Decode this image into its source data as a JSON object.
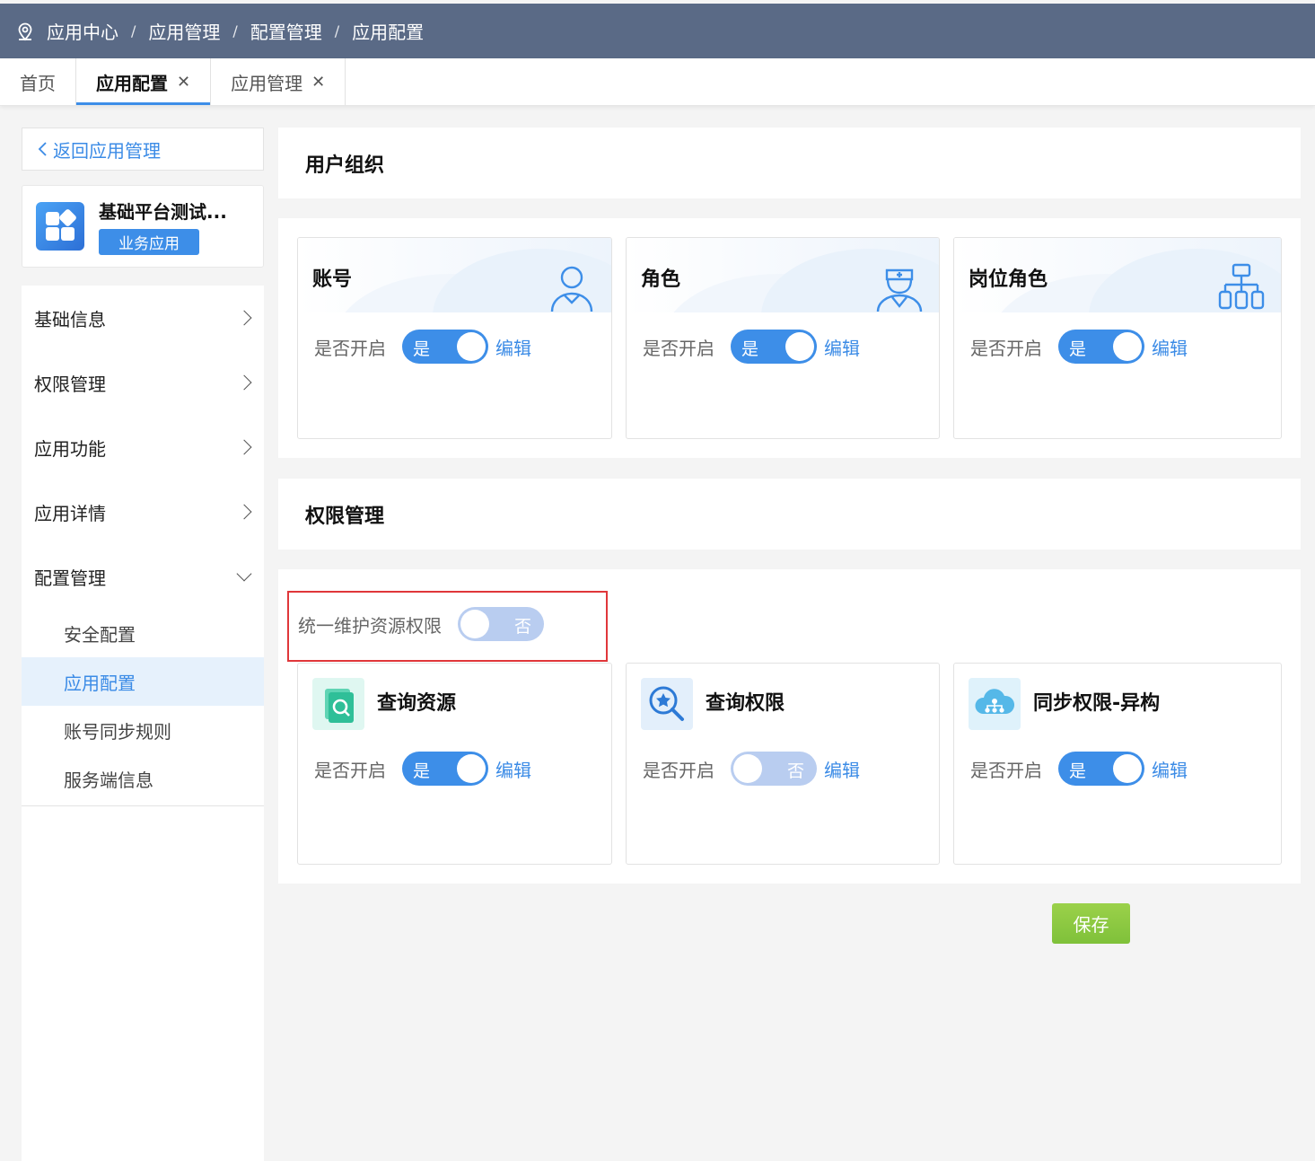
{
  "breadcrumb": [
    "应用中心",
    "应用管理",
    "配置管理",
    "应用配置"
  ],
  "breadcrumb_sep": "/",
  "tabs": [
    {
      "label": "首页",
      "closable": false,
      "active": false
    },
    {
      "label": "应用配置",
      "closable": true,
      "active": true
    },
    {
      "label": "应用管理",
      "closable": true,
      "active": false
    }
  ],
  "close_glyph": "✕",
  "sidebar": {
    "back_label": "返回应用管理",
    "app_name": "基础平台测试...",
    "app_tag": "业务应用",
    "menu": [
      {
        "label": "基础信息",
        "expanded": false
      },
      {
        "label": "权限管理",
        "expanded": false
      },
      {
        "label": "应用功能",
        "expanded": false
      },
      {
        "label": "应用详情",
        "expanded": false
      },
      {
        "label": "配置管理",
        "expanded": true
      }
    ],
    "submenu": [
      {
        "label": "安全配置",
        "active": false
      },
      {
        "label": "应用配置",
        "active": true
      },
      {
        "label": "账号同步规则",
        "active": false
      },
      {
        "label": "服务端信息",
        "active": false
      }
    ]
  },
  "sections": {
    "user_org": {
      "title": "用户组织",
      "cards": [
        {
          "title": "账号",
          "icon": "user-icon",
          "row_label": "是否开启",
          "enabled": true,
          "switch_label": "是",
          "edit_label": "编辑"
        },
        {
          "title": "角色",
          "icon": "doctor-icon",
          "row_label": "是否开启",
          "enabled": true,
          "switch_label": "是",
          "edit_label": "编辑"
        },
        {
          "title": "岗位角色",
          "icon": "org-chart-icon",
          "row_label": "是否开启",
          "enabled": true,
          "switch_label": "是",
          "edit_label": "编辑"
        }
      ]
    },
    "permission": {
      "title": "权限管理",
      "unified_label": "统一维护资源权限",
      "unified_enabled": false,
      "unified_switch_label": "否",
      "cards": [
        {
          "title": "查询资源",
          "icon": "search-resource-icon",
          "row_label": "是否开启",
          "enabled": true,
          "switch_label": "是",
          "edit_label": "编辑"
        },
        {
          "title": "查询权限",
          "icon": "search-permission-icon",
          "row_label": "是否开启",
          "enabled": false,
          "switch_label": "否",
          "edit_label": "编辑"
        },
        {
          "title": "同步权限-异构",
          "icon": "cloud-sync-icon",
          "row_label": "是否开启",
          "enabled": true,
          "switch_label": "是",
          "edit_label": "编辑"
        }
      ]
    }
  },
  "save_label": "保存",
  "colors": {
    "header_bg": "#5a6a86",
    "primary": "#3d8ee8",
    "switch_off": "#b9cdf0",
    "save_button": "#8cc63f",
    "highlight_border": "#e0373a"
  }
}
